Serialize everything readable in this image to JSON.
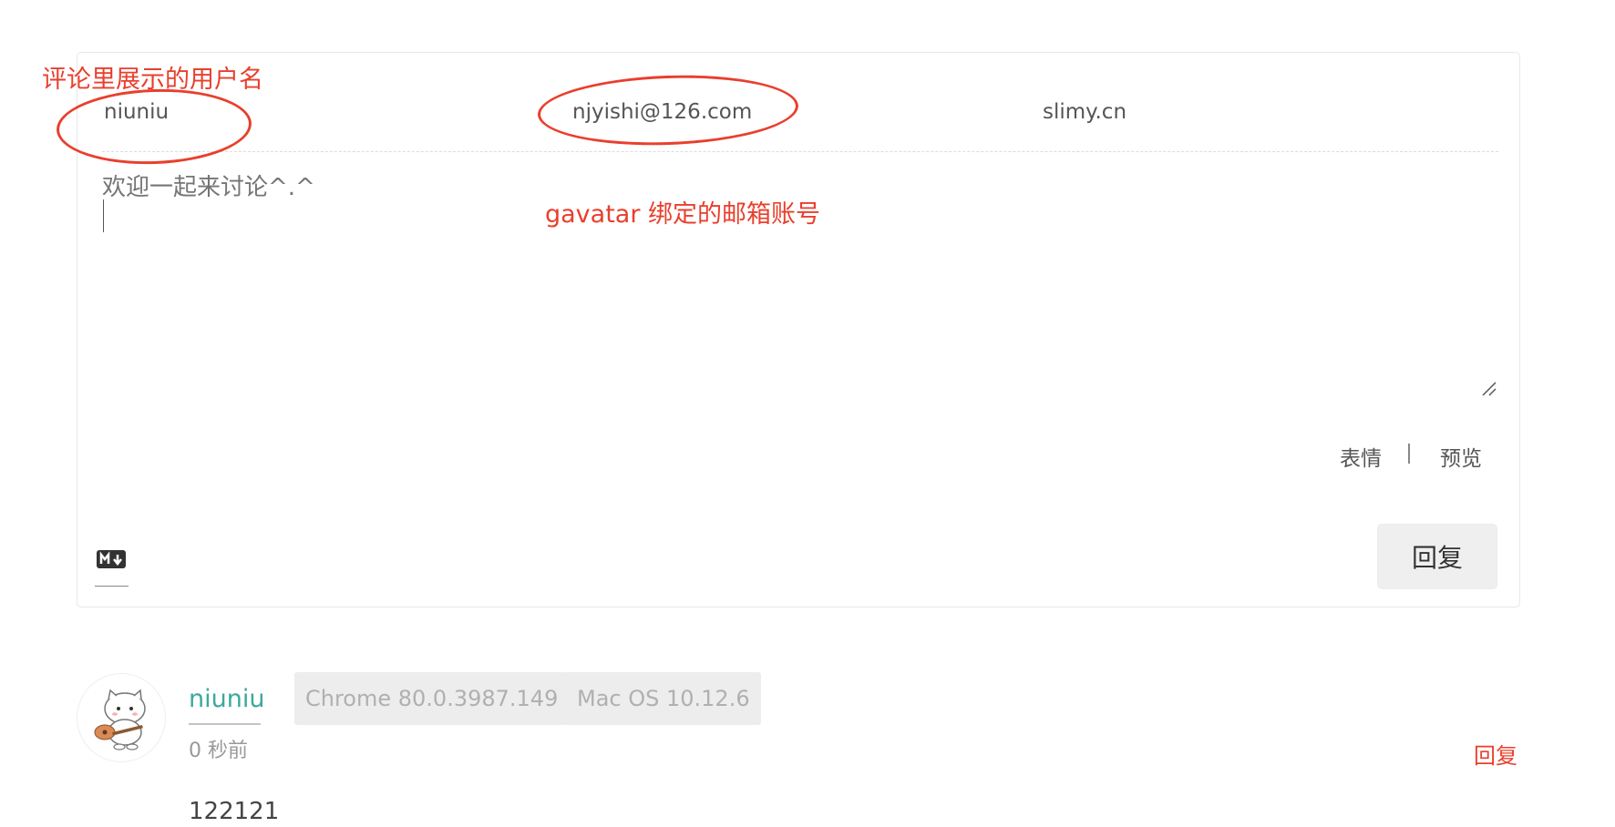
{
  "form": {
    "nickname_value": "niuniu",
    "email_value": "njyishi@126.com",
    "link_value": "slimy.cn",
    "textarea_placeholder": "欢迎一起来讨论^.^",
    "emoji_label": "表情",
    "preview_label": "预览",
    "markdown_icon": "markdown-icon",
    "submit_label": "回复"
  },
  "annotations": {
    "nickname_note": "评论里展示的用户名",
    "email_note": "gavatar 绑定的邮箱账号",
    "highlight_color": "#e93f2d"
  },
  "comment": {
    "avatar_icon": "cat-avatar-icon",
    "nickname": "niuniu",
    "browser": "Chrome 80.0.3987.149",
    "os": "Mac OS 10.12.6",
    "time": "0 秒前",
    "reply_label": "回复",
    "content": "122121",
    "nickname_color": "#3da89c"
  }
}
